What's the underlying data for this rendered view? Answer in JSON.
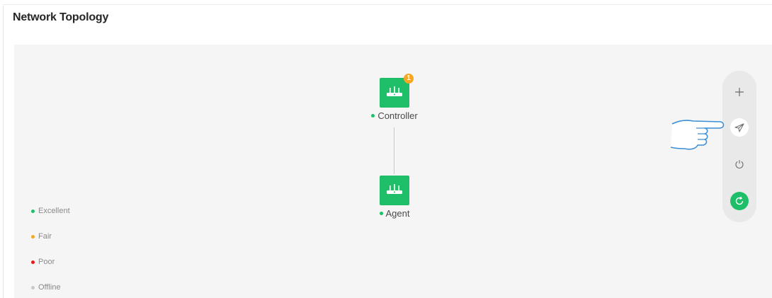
{
  "header": {
    "title": "Network Topology"
  },
  "colors": {
    "excellent": "#1fbf6a",
    "fair": "#f5a623",
    "poor": "#e81919",
    "offline": "#c8c8c8",
    "node_fill": "#1fbf6a",
    "badge": "#f5a623"
  },
  "topology": {
    "nodes": [
      {
        "label": "Controller",
        "status": "excellent",
        "icon": "router-icon",
        "badge_count": "1"
      },
      {
        "label": "Agent",
        "status": "excellent",
        "icon": "router-icon"
      }
    ],
    "links": [
      {
        "from": "Controller",
        "to": "Agent"
      }
    ]
  },
  "legend": {
    "items": [
      {
        "label": "Excellent",
        "status": "excellent"
      },
      {
        "label": "Fair",
        "status": "fair"
      },
      {
        "label": "Poor",
        "status": "poor"
      },
      {
        "label": "Offline",
        "status": "offline"
      }
    ]
  },
  "toolbar": {
    "buttons": [
      {
        "name": "zoom-in",
        "icon": "plus-icon"
      },
      {
        "name": "send",
        "icon": "paper-plane-icon",
        "highlighted": true
      },
      {
        "name": "power",
        "icon": "power-icon"
      },
      {
        "name": "refresh",
        "icon": "refresh-icon",
        "active": true
      }
    ]
  }
}
